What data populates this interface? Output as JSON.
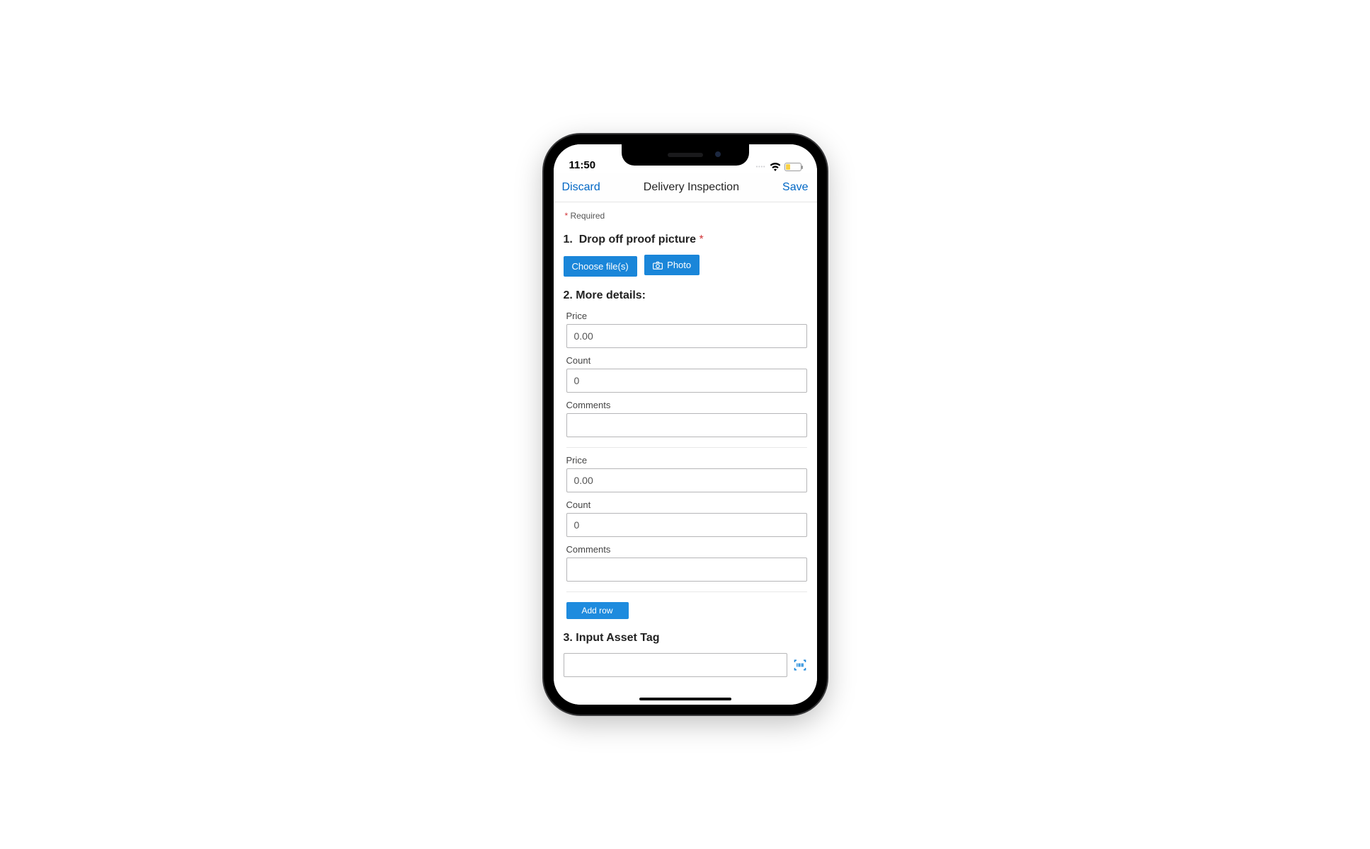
{
  "status": {
    "time": "11:50"
  },
  "nav": {
    "discard": "Discard",
    "title": "Delivery Inspection",
    "save": "Save"
  },
  "required_label": "Required",
  "q1": {
    "number": "1.",
    "title": "Drop off proof picture",
    "choose_btn": "Choose file(s)",
    "photo_btn": "Photo"
  },
  "q2": {
    "number": "2.",
    "title": "More details:",
    "rows": [
      {
        "price_label": "Price",
        "price_val": "0.00",
        "count_label": "Count",
        "count_val": "0",
        "comments_label": "Comments",
        "comments_val": ""
      },
      {
        "price_label": "Price",
        "price_val": "0.00",
        "count_label": "Count",
        "count_val": "0",
        "comments_label": "Comments",
        "comments_val": ""
      }
    ],
    "add_row": "Add row"
  },
  "q3": {
    "number": "3.",
    "title": "Input Asset Tag",
    "value": ""
  }
}
